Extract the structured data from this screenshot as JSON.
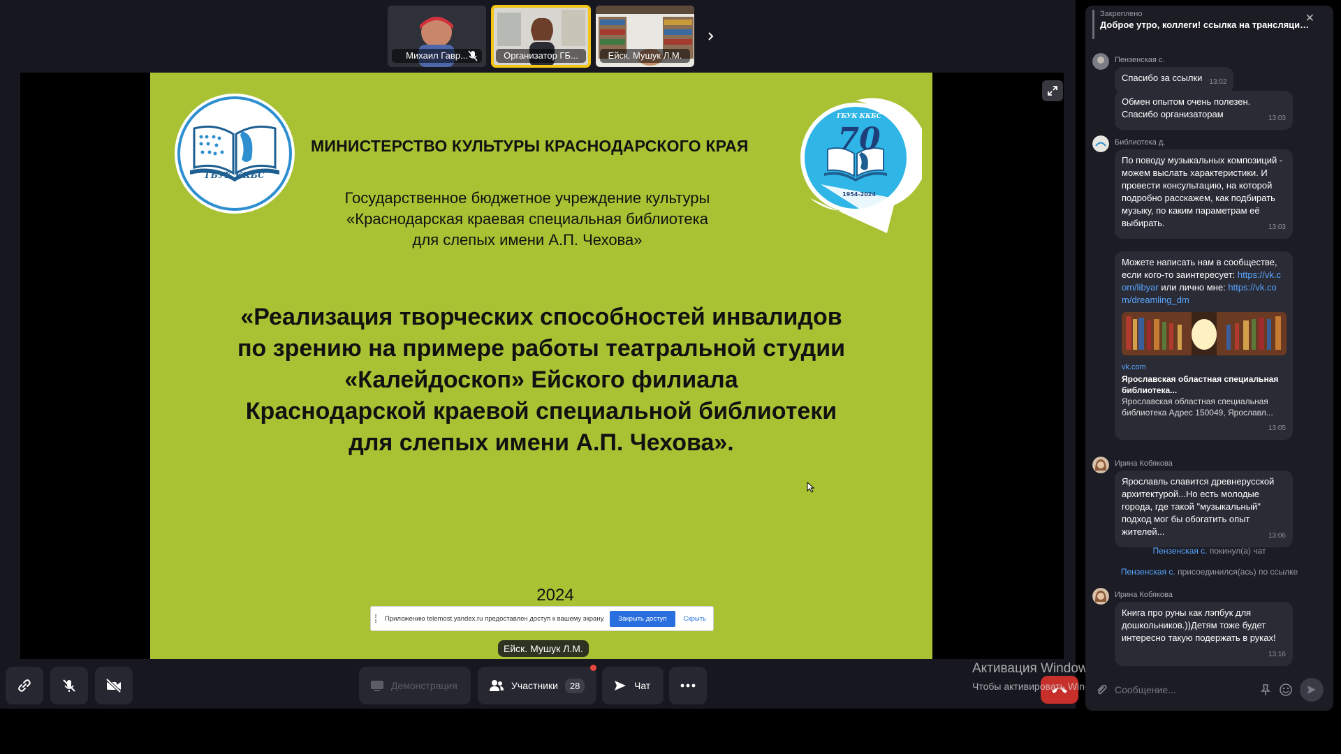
{
  "participants_strip": [
    {
      "name": "Михаил Гавр...",
      "muted": true,
      "active": false
    },
    {
      "name": "Организатор ГБ...",
      "muted": false,
      "active": true
    },
    {
      "name": "Ейск. Мушук Л.М.",
      "muted": false,
      "active": false
    }
  ],
  "slide": {
    "ministry": "МИНИСТЕРСТВО КУЛЬТУРЫ КРАСНОДАРСКОГО КРАЯ",
    "institution_line1": "Государственное бюджетное учреждение культуры",
    "institution_line2": "«Краснодарская краевая специальная библиотека",
    "institution_line3": "для слепых имени А.П. Чехова»",
    "title_line1": "«Реализация творческих способностей инвалидов",
    "title_line2": "по зрению на примере работы театральной студии",
    "title_line3": "«Калейдоскоп» Ейского филиала",
    "title_line4": "Краснодарской краевой специальной библиотеки",
    "title_line5": "для слепых имени А.П. Чехова».",
    "year": "2024",
    "logo_left_text": "ГБУК ККБС",
    "logo_right_text": "ГБУК ККБС",
    "logo_right_number": "70",
    "logo_right_years": "1954-2024"
  },
  "share_notice": {
    "text": "Приложению telemost.yandex.ru предоставлен доступ к вашему экрану.",
    "stop_label": "Закрыть доступ",
    "hide_label": "Скрыть"
  },
  "speaker_label": "Ейск. Мушук Л.М.",
  "toolbar": {
    "demo_label": "Демонстрация",
    "participants_label": "Участники",
    "participants_count": "28",
    "chat_label": "Чат"
  },
  "windows_watermark": {
    "title": "Активация Windows",
    "subtitle": "Чтобы активировать Windows, перейдите в раздел \"Параметры\"."
  },
  "chat": {
    "pinned_label": "Закреплено",
    "pinned_text": "Доброе утро, коллеги! ссылка на трансляцию в ...",
    "messages": [
      {
        "author": "Пензенская с.",
        "text": "Спасибо за ссылки",
        "time": "13:02"
      },
      {
        "author": "",
        "text": "Обмен опытом очень полезен. Спасибо организаторам",
        "time": "13:03"
      },
      {
        "author": "Библиотека д.",
        "text": "По поводу музыкальных композиций - можем выслать характеристики. И провести консультацию, на которой подробно расскажем, как подбирать музыку, по каким параметрам её выбирать.",
        "time": "13:03"
      },
      {
        "author": "",
        "text_before": "Можете написать нам в сообществе, если кого-то заинтересует:",
        "link1": "https://vk.com/libyar",
        "text_middle": "или лично мне:",
        "link2": "https://vk.com/dreamling_dm",
        "preview_site": "vk.com",
        "preview_title": "Ярославская областная специальная библиотека...",
        "preview_desc": "Ярославская областная специальная библиотека Адрес 150049, Ярославл...",
        "time": "13:05"
      },
      {
        "author": "Ирина Кобякова",
        "text": "Ярославль славится древнерусской архитектурой...Но есть молодые города, где такой \"музыкальный\" подход мог бы обогатить опыт жителей...",
        "time": "13:06"
      },
      {
        "author": "Ирина Кобякова",
        "text": "Книга про руны как лэпбук для дошкольников.))Детям тоже будет интересно такую подержать в руках!",
        "time": "13:16"
      }
    ],
    "system_1_who": "Пензенская с.",
    "system_1_action": " покинул(а) чат",
    "system_2_who": "Пензенская с.",
    "system_2_action": " присоединился(ась) по ссылке",
    "input_placeholder": "Сообщение..."
  },
  "colors": {
    "slide_bg": "#a8c233",
    "accent_active": "#f2c519",
    "link": "#59a6ff",
    "hangup": "#c62f2a"
  }
}
